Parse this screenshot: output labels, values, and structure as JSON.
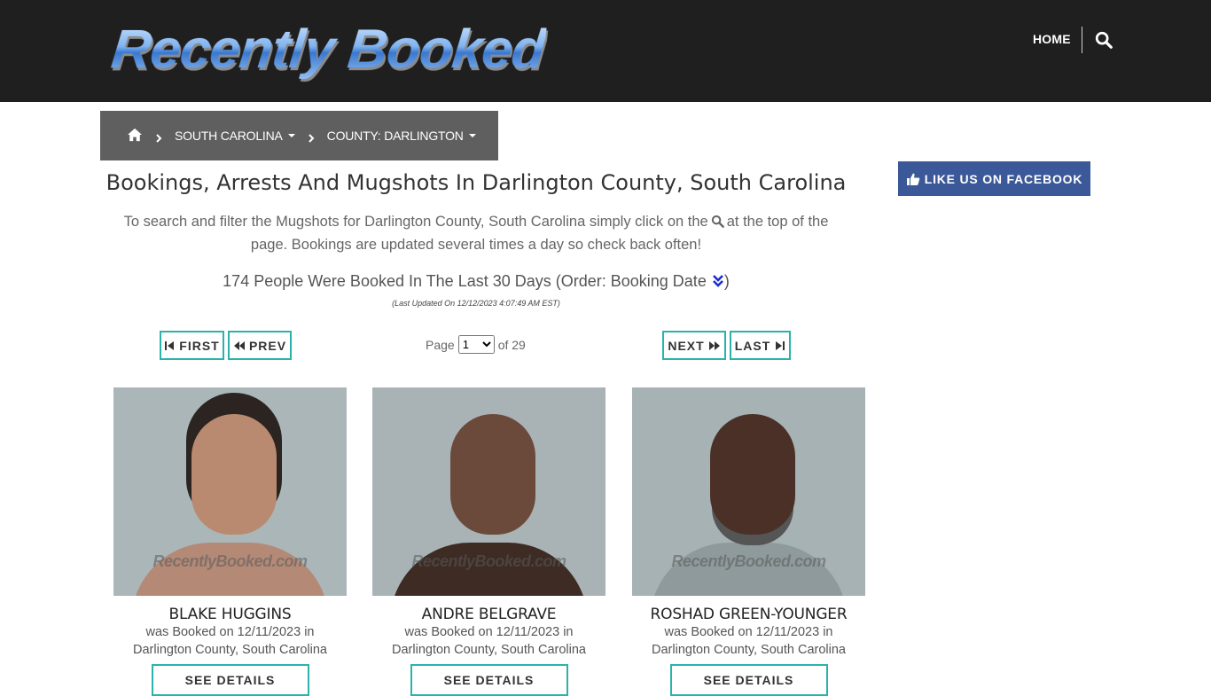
{
  "header": {
    "logo_text": "Recently Booked",
    "nav_home": "HOME"
  },
  "breadcrumb": {
    "state": "SOUTH CAROLINA",
    "county": "COUNTY: DARLINGTON"
  },
  "facebook_button": "LIKE US ON FACEBOOK",
  "page_title": "Bookings, Arrests And Mugshots In Darlington County, South Carolina",
  "intro": {
    "before_icon": "To search and filter the Mugshots for Darlington County, South Carolina simply click on the",
    "after_icon": "at the top of the page. Bookings are updated several times a day so check back often!"
  },
  "summary": {
    "text": "174 People Were Booked In The Last 30 Days (Order: Booking Date",
    "close": ")"
  },
  "last_updated": "(Last Updated On 12/12/2023 4:07:49 AM EST)",
  "pagination": {
    "first": "FIRST",
    "prev": "PREV",
    "next": "NEXT",
    "last": "LAST",
    "page_label": "Page",
    "current_page": "1",
    "of_label": "of 29"
  },
  "watermark": "RecentlyBooked.com",
  "inmates": [
    {
      "name": "BLAKE HUGGINS",
      "booked_line": "was Booked on 12/11/2023 in",
      "location": "Darlington County, South Carolina",
      "button": "SEE DETAILS"
    },
    {
      "name": "ANDRE BELGRAVE",
      "booked_line": "was Booked on 12/11/2023 in",
      "location": "Darlington County, South Carolina",
      "button": "SEE DETAILS"
    },
    {
      "name": "ROSHAD GREEN-YOUNGER",
      "booked_line": "was Booked on 12/11/2023 in",
      "location": "Darlington County, South Carolina",
      "button": "SEE DETAILS"
    }
  ],
  "colors": {
    "header_bg": "#1f1f1f",
    "breadcrumb_bg": "#5f5f5f",
    "facebook_blue": "#3b5998",
    "teal_border": "#2bb3ab"
  },
  "icons": [
    "search-icon",
    "home-icon",
    "chevron-right-icon",
    "caret-down-icon",
    "thumbs-up-icon",
    "double-chevron-down-icon",
    "step-backward-icon",
    "backward-icon",
    "forward-icon",
    "step-forward-icon"
  ]
}
